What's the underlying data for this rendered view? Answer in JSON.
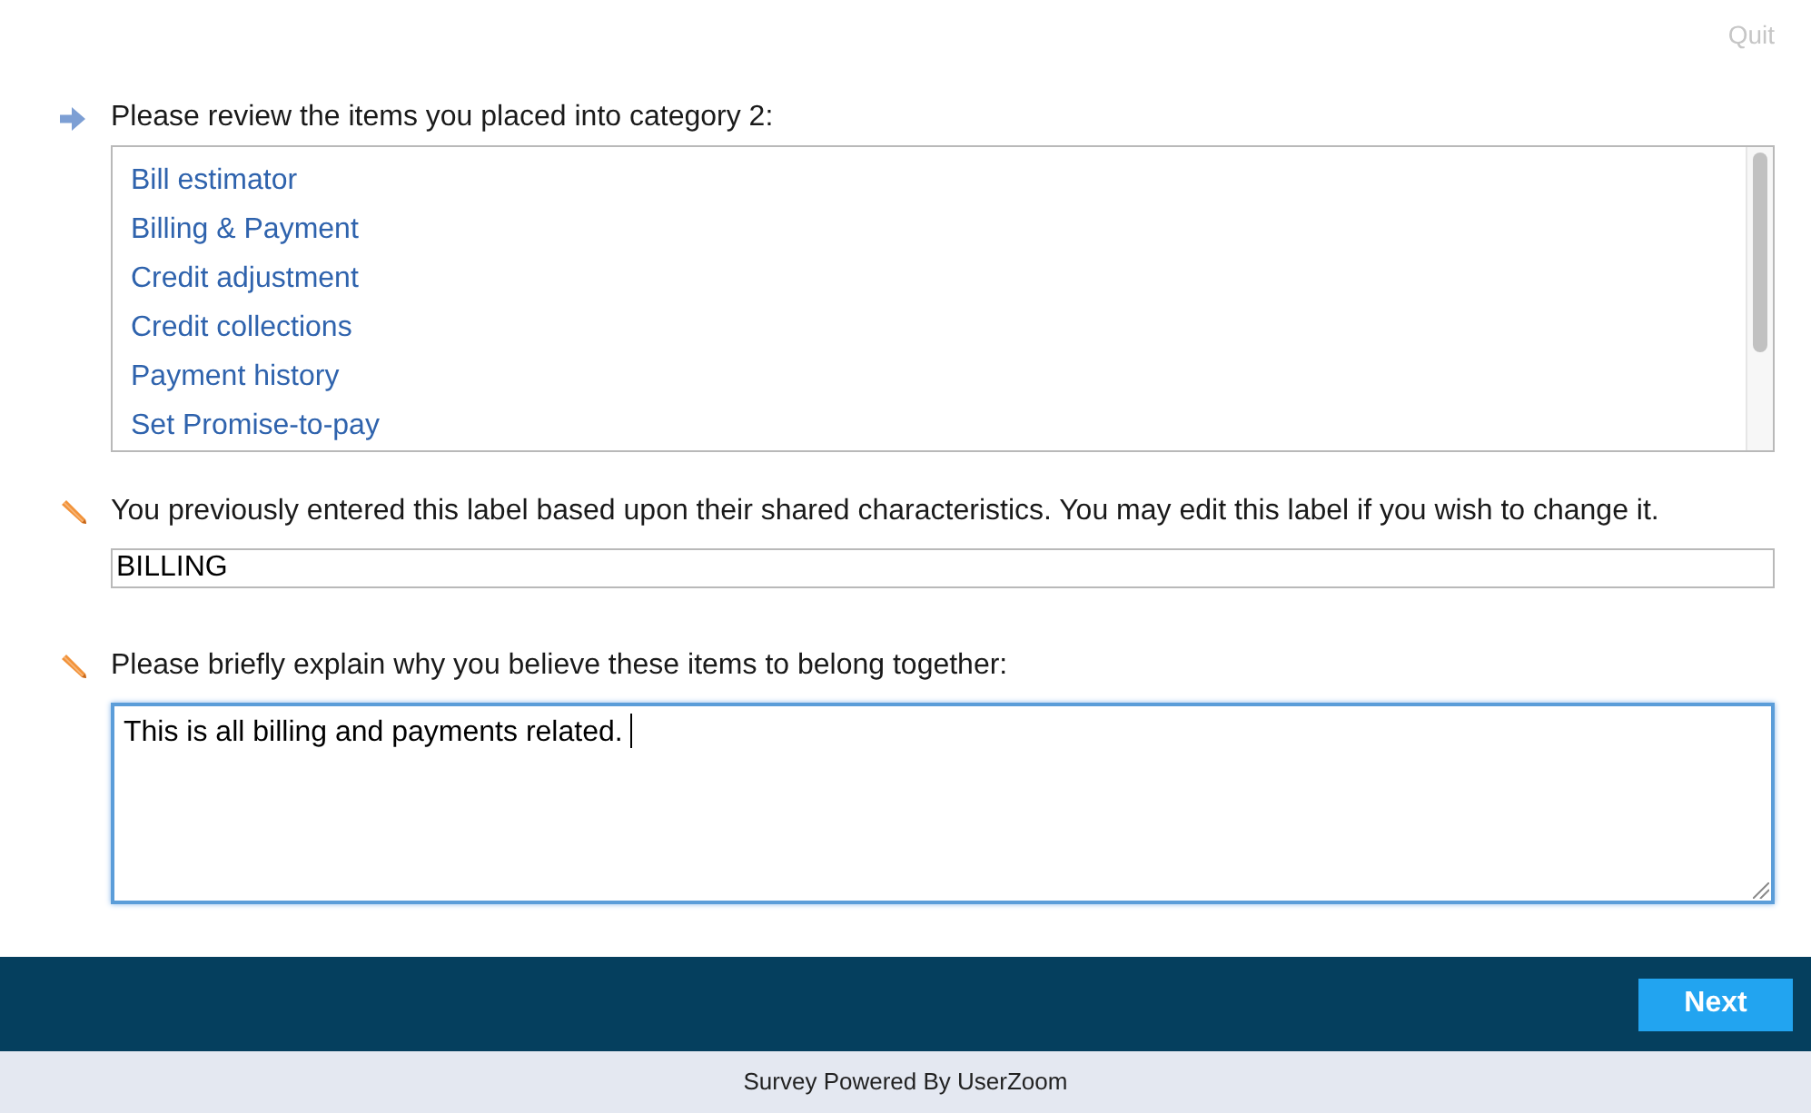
{
  "header": {
    "quit": "Quit"
  },
  "questions": [
    {
      "kind": "review",
      "prompt": "Please review the items you placed into category 2:",
      "items": [
        "Bill estimator",
        "Billing & Payment",
        "Credit adjustment",
        "Credit collections",
        "Payment history",
        "Set Promise-to-pay"
      ]
    },
    {
      "kind": "label",
      "prompt": "You previously entered this label based upon their shared characteristics. You may edit this label if you wish to change it.",
      "value": "BILLING",
      "focused": false
    },
    {
      "kind": "explanation",
      "prompt": "Please briefly explain why you believe these items to belong together:",
      "value": "This is all billing and payments related.",
      "focused": true
    }
  ],
  "footer": {
    "next": "Next",
    "powered_by": "Survey Powered By UserZoom"
  }
}
